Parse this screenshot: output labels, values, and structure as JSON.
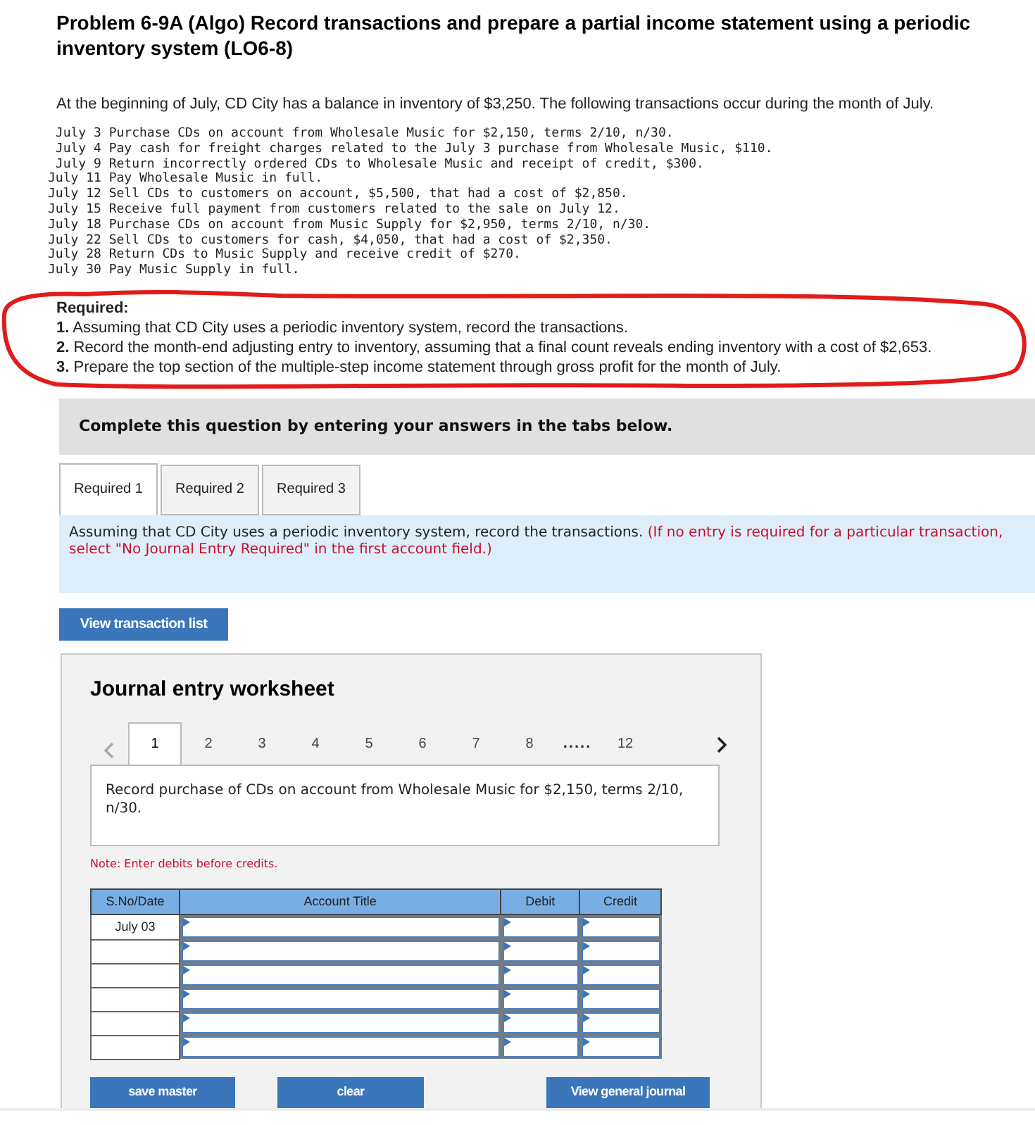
{
  "title": "Problem 6-9A (Algo) Record transactions and prepare a partial income statement using a periodic inventory system (LO6-8)",
  "intro": "At the beginning of July, CD City has a balance in inventory of $3,250. The following transactions occur during the month of July.",
  "transactions": [
    {
      "date": "July 3",
      "text": "Purchase CDs on account from Wholesale Music for $2,150, terms 2/10, n/30."
    },
    {
      "date": "July 4",
      "text": "Pay cash for freight charges related to the July 3 purchase from Wholesale Music, $110."
    },
    {
      "date": "July 9",
      "text": "Return incorrectly ordered CDs to Wholesale Music and receipt of credit, $300."
    },
    {
      "date": "July 11",
      "text": "Pay Wholesale Music in full."
    },
    {
      "date": "July 12",
      "text": "Sell CDs to customers on account, $5,500, that had a cost of $2,850."
    },
    {
      "date": "July 15",
      "text": "Receive full payment from customers related to the sale on July 12."
    },
    {
      "date": "July 18",
      "text": "Purchase CDs on account from Music Supply for $2,950, terms 2/10, n/30."
    },
    {
      "date": "July 22",
      "text": "Sell CDs to customers for cash, $4,050, that had a cost of $2,350."
    },
    {
      "date": "July 28",
      "text": "Return CDs to Music Supply and receive credit of $270."
    },
    {
      "date": "July 30",
      "text": "Pay Music Supply in full."
    }
  ],
  "required": {
    "heading": "Required:",
    "items": [
      "**1.** Assuming that CD City uses a periodic inventory system, record the transactions.",
      "**2.** Record the month-end adjusting entry to inventory, assuming that a final count reveals ending inventory with a cost of $2,653.",
      "**3.** Prepare the top section of the multiple-step income statement through gross profit for the month of July."
    ]
  },
  "banner": "Complete this question by entering your answers in the tabs below.",
  "tabs": [
    {
      "label": "Required 1",
      "selected": true
    },
    {
      "label": "Required 2",
      "selected": false
    },
    {
      "label": "Required 3",
      "selected": false
    }
  ],
  "instruction": {
    "text": "Assuming that CD City uses a periodic inventory system, record the transactions.",
    "note": "(If no entry is required for a particular transaction, select \"No Journal Entry Required\" in the first account field.)"
  },
  "view_list_button": "View transaction list",
  "worksheet": {
    "title": "Journal entry worksheet",
    "prev_disabled": true,
    "pages": [
      {
        "label": "1",
        "selected": true
      },
      {
        "label": "2",
        "selected": false
      },
      {
        "label": "3",
        "selected": false
      },
      {
        "label": "4",
        "selected": false
      },
      {
        "label": "5",
        "selected": false
      },
      {
        "label": "6",
        "selected": false
      },
      {
        "label": "7",
        "selected": false
      },
      {
        "label": "8",
        "selected": false
      },
      {
        "label": ".....",
        "kind": "ellipsis"
      },
      {
        "label": "12",
        "selected": false
      }
    ],
    "description": "Record purchase of CDs on account from Wholesale Music for $2,150, terms 2/10, n/30.",
    "note": "Note: Enter debits before credits.",
    "columns": [
      "S.No/Date",
      "Account Title",
      "Debit",
      "Credit"
    ],
    "rows": [
      {
        "date": "July 03"
      },
      {},
      {},
      {},
      {},
      {}
    ],
    "buttons": [
      "save master",
      "clear",
      "View general journal"
    ]
  }
}
